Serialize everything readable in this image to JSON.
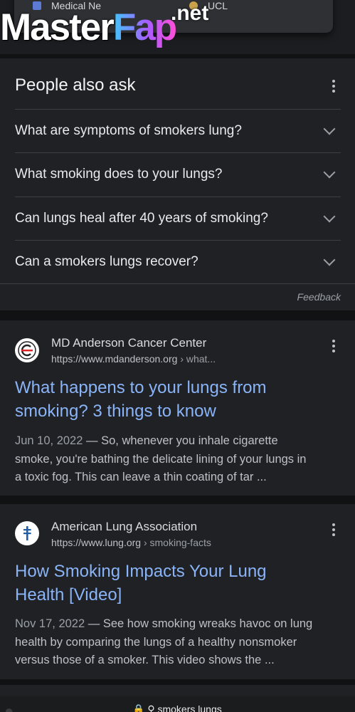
{
  "top_carousel": {
    "items": [
      {
        "label": "Medical Ne"
      },
      {
        "label": "UCL"
      }
    ]
  },
  "watermark": {
    "part1": "Master",
    "part2": "Fap",
    "suffix": ".net"
  },
  "people_also_ask": {
    "title": "People also ask",
    "questions": [
      "What are symptoms of smokers lung?",
      "What smoking does to your lungs?",
      "Can lungs heal after 40 years of smoking?",
      "Can a smokers lungs recover?"
    ],
    "feedback_label": "Feedback"
  },
  "results": [
    {
      "source": "MD Anderson Cancer Center",
      "url": "https://www.mdanderson.org",
      "breadcrumb": "› what...",
      "favicon": "md-anderson-logo-icon",
      "title_line1": "What happens to your lungs from",
      "title_line2": "smoking? 3 things to know",
      "date": "Jun 10, 2022",
      "snippet_line1": " — So, whenever you inhale cigarette",
      "snippet_line2": "smoke, you're bathing the delicate lining of your lungs in",
      "snippet_line3": "a toxic fog. This can leave a thin coating of tar ..."
    },
    {
      "source": "American Lung Association",
      "url": "https://www.lung.org",
      "breadcrumb": "› smoking-facts",
      "favicon": "lung-association-cross-icon",
      "title_line1": "How Smoking Impacts Your Lung",
      "title_line2": "Health [Video]",
      "date": "Nov 17, 2022",
      "snippet_line1": " — See how smoking wreaks havoc on lung",
      "snippet_line2": "health by comparing the lungs of a healthy nonsmoker",
      "snippet_line3": "versus those of a smoker. This video shows the ..."
    }
  ],
  "address_bar": {
    "text": "smokers lungs",
    "icons": [
      "lock-icon",
      "search-icon"
    ]
  },
  "colors": {
    "link": "#8ab4f8",
    "card": "#202124",
    "page": "#111214",
    "text": "#e8eaed"
  }
}
